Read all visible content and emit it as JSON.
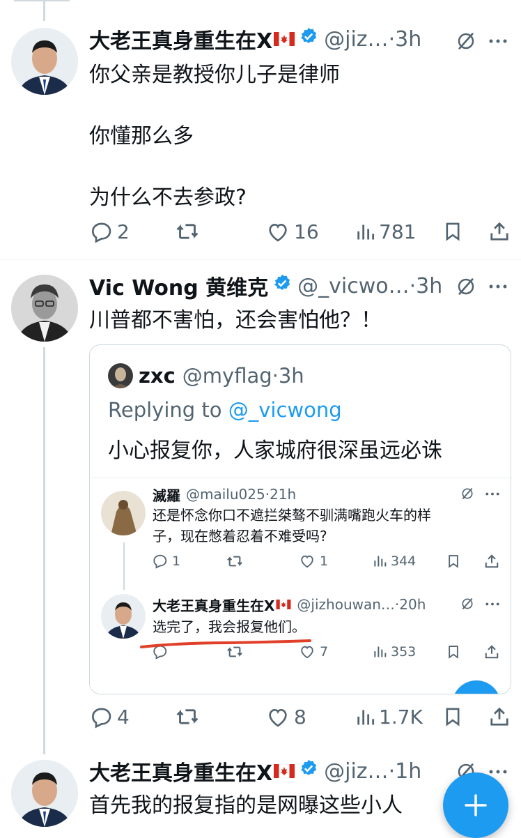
{
  "tweets": [
    {
      "name": "大老王真身重生在X",
      "handle": "@jiz…",
      "sep": "·",
      "time": "3h",
      "text": "你父亲是教授你儿子是律师\n\n你懂那么多\n\n为什么不去参政?",
      "replies": "2",
      "retweets": "",
      "likes": "16",
      "views": "781"
    },
    {
      "name": "Vic Wong 黄维克",
      "handle": "@_vicwo…",
      "sep": "·",
      "time": "3h",
      "text": "川普都不害怕，还会害怕他？！",
      "replies": "4",
      "retweets": "",
      "likes": "8",
      "views": "1.7K"
    },
    {
      "name": "大老王真身重生在X",
      "handle": "@jiz…",
      "sep": "·",
      "time": "1h",
      "text": "首先我的报复指的是网曝这些小人"
    }
  ],
  "quote": {
    "name": "zxc",
    "handle": "@myflag",
    "sep": "·",
    "time": "3h",
    "replying_prefix": "Replying to ",
    "replying_handle": "@_vicwong",
    "text": "小心报复你，人家城府很深虽远必诛",
    "nested": [
      {
        "name": "滅羅",
        "handle": "@mailu025",
        "sep": "·",
        "time": "21h",
        "text": "还是怀念你口不遮拦桀骜不驯满嘴跑火车的样\n子，现在憋着忍着不难受吗?",
        "replies": "1",
        "likes": "1",
        "views": "344"
      },
      {
        "name": "大老王真身重生在X",
        "handle": "@jizhouwan…",
        "sep": "·",
        "time": "20h",
        "text": "选完了，我会报复他们。",
        "likes": "7",
        "views": "353"
      }
    ]
  },
  "icons": {
    "reply": "reply-icon",
    "retweet": "retweet-icon",
    "like": "heart-icon",
    "views": "views-icon",
    "bookmark": "bookmark-icon",
    "share": "share-icon",
    "grok": "grok-icon",
    "more": "more-icon",
    "compose": "plus-icon"
  },
  "colors": {
    "accent": "#1d9bf0",
    "text": "#0f1419",
    "muted": "#536471",
    "annotation": "#e0402a"
  }
}
